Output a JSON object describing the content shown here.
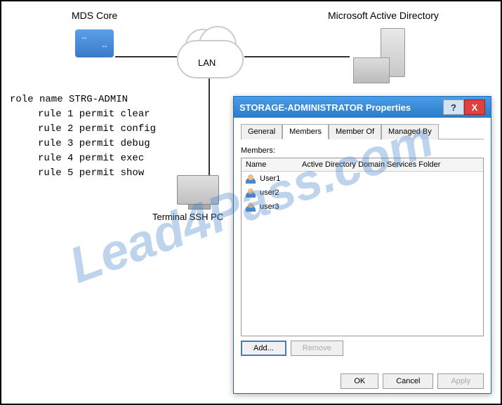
{
  "diagram": {
    "mds_label": "MDS Core",
    "msad_label": "Microsoft Active Directory",
    "lan_label": "LAN",
    "terminal_label": "Terminal SSH PC"
  },
  "config": {
    "line0": "role name STRG-ADMIN",
    "line1": "rule 1 permit clear",
    "line2": "rule 2 permit config",
    "line3": "rule 3 permit debug",
    "line4": "rule 4 permit exec",
    "line5": "rule 5 permit show"
  },
  "dialog": {
    "title": "STORAGE-ADMINISTRATOR Properties",
    "help": "?",
    "close": "X",
    "tabs": {
      "general": "General",
      "members": "Members",
      "memberof": "Member Of",
      "managedby": "Managed By"
    },
    "members_label": "Members:",
    "columns": {
      "name": "Name",
      "folder": "Active Directory Domain Services Folder"
    },
    "rows": [
      {
        "name": "User1"
      },
      {
        "name": "user2"
      },
      {
        "name": "user3"
      }
    ],
    "buttons": {
      "add": "Add...",
      "remove": "Remove",
      "ok": "OK",
      "cancel": "Cancel",
      "apply": "Apply"
    }
  },
  "watermark": "Lead4Pass.com"
}
